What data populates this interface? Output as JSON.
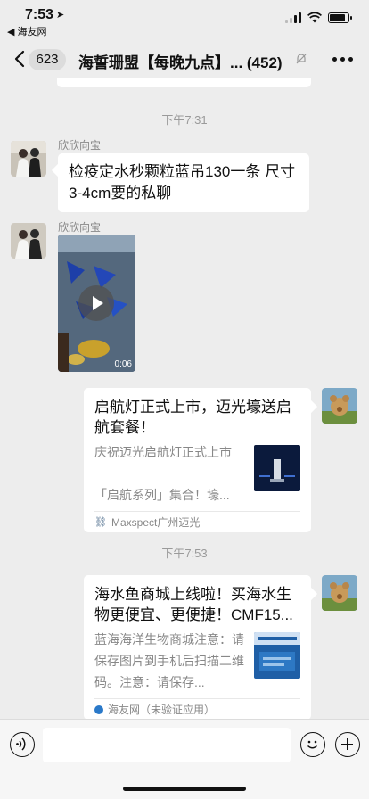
{
  "status": {
    "time": "7:53",
    "location_icon": "location-arrow-icon",
    "back_app": "◀ 海友网",
    "battery_level": 0.85
  },
  "nav": {
    "unread_count": "623",
    "title": "海誓珊盟【每晚九点】...  (452)",
    "muted_icon": "bell-muted-icon",
    "more_icon": "more-icon"
  },
  "messages": [
    {
      "type": "time",
      "text": "下午7:31"
    },
    {
      "type": "text",
      "sender": "欣欣向宝",
      "text": "检疫定水秒颗粒蓝吊130一条 尺寸3-4cm要的私聊"
    },
    {
      "type": "video",
      "sender": "欣欣向宝",
      "duration": "0:06"
    },
    {
      "type": "card",
      "title": "启航灯正式上市，迈光壕送启航套餐！",
      "desc": "庆祝迈光启航灯正式上市\n\n「启航系列」集合！壕...",
      "source": "Maxspect广州迈光"
    },
    {
      "type": "time",
      "text": "下午7:53"
    },
    {
      "type": "card",
      "title": "海水鱼商城上线啦！买海水生物更便宜、更便捷！CMF15...",
      "desc": "蓝海海洋生物商城注意：请保存图片到手机后扫描二维码。注意：请保存...",
      "source": "海友网（未验证应用）"
    }
  ],
  "input": {
    "placeholder": ""
  },
  "colors": {
    "background": "#ededed",
    "bubble": "#ffffff",
    "muted_text": "#888888"
  }
}
